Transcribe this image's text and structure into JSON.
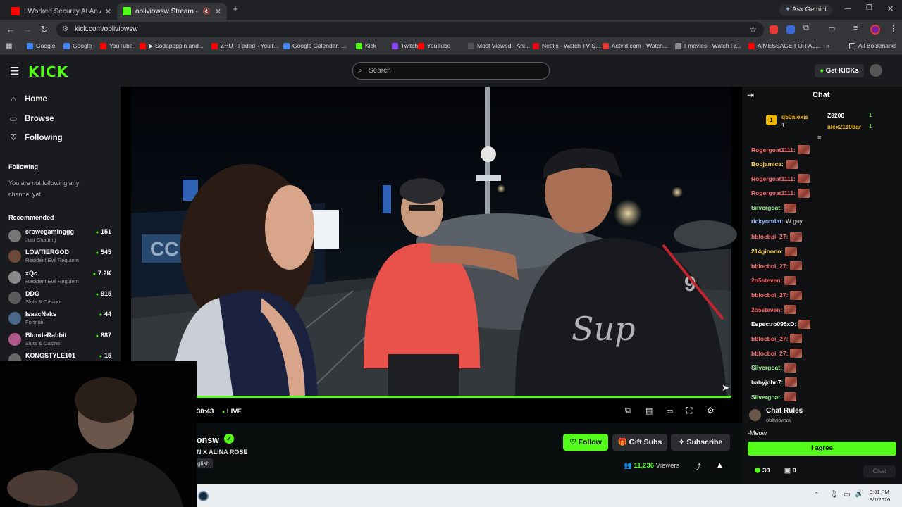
{
  "browser": {
    "tabs": [
      {
        "title": "I Worked Security At An Aband",
        "color": "#ff0000",
        "active": false
      },
      {
        "title": "obliviowsw Stream - Watch",
        "color": "#53fc18",
        "active": true
      }
    ],
    "new_tab": "+",
    "url": "kick.com/obliviowsw",
    "gemini_label": "Ask Gemini",
    "bookmarks": [
      {
        "label": "Google",
        "color": "#4285f4"
      },
      {
        "label": "Google",
        "color": "#4285f4"
      },
      {
        "label": "YouTube",
        "color": "#ff0000"
      },
      {
        "label": "▶ Sodapoppin and...",
        "color": "#ff0000"
      },
      {
        "label": "ZHU - Faded - YouT...",
        "color": "#ff0000"
      },
      {
        "label": "Google Calendar -...",
        "color": "#4285f4"
      },
      {
        "label": "Kick",
        "color": "#53fc18"
      },
      {
        "label": "Twitch",
        "color": "#9146ff"
      },
      {
        "label": "YouTube",
        "color": "#ff0000"
      },
      {
        "label": "Most Viewed - Ani...",
        "color": "#555555"
      },
      {
        "label": "Netflix - Watch TV S...",
        "color": "#e50914"
      },
      {
        "label": "Actvid.com - Watch...",
        "color": "#e53935"
      },
      {
        "label": "Fmovies - Watch Fr...",
        "color": "#888888"
      },
      {
        "label": "A MESSAGE FOR AL...",
        "color": "#ff0000"
      }
    ],
    "all_bookmarks": "All Bookmarks"
  },
  "header": {
    "logo": "KICK",
    "search_placeholder": "Search",
    "get_kicks": "Get KICKs"
  },
  "sidebar": {
    "nav": [
      {
        "label": "Home",
        "icon": "home-icon"
      },
      {
        "label": "Browse",
        "icon": "browse-icon"
      },
      {
        "label": "Following",
        "icon": "heart-icon"
      }
    ],
    "following_heading": "Following",
    "following_empty": "You are not following any channel yet.",
    "recommended_heading": "Recommended",
    "recommended": [
      {
        "name": "crowegaminggg",
        "category": "Just Chatting",
        "viewers": "151",
        "color": "#777"
      },
      {
        "name": "LOWTIERGOD",
        "category": "Resident Evil Requiem",
        "viewers": "545",
        "color": "#6b4a3a"
      },
      {
        "name": "xQc",
        "category": "Resident Evil Requiem",
        "viewers": "7.2K",
        "color": "#888"
      },
      {
        "name": "DDG",
        "category": "Slots & Casino",
        "viewers": "915",
        "color": "#5a5a5a"
      },
      {
        "name": "IsaacNaks",
        "category": "Fortnite",
        "viewers": "44",
        "color": "#4a6a8a"
      },
      {
        "name": "BlondeRabbit",
        "category": "Slots & Casino",
        "viewers": "887",
        "color": "#b05a8a"
      },
      {
        "name": "KONGSTYLE101",
        "category": "",
        "viewers": "15",
        "color": "#666"
      }
    ]
  },
  "player": {
    "time": "30:43",
    "live": "LIVE",
    "progress": 1.0
  },
  "stream": {
    "channel": "onsw",
    "title": "N X ALINA ROSE",
    "tag": "glish",
    "follow": "Follow",
    "gift_subs": "Gift Subs",
    "subscribe": "Subscribe",
    "viewers": "11,236",
    "viewers_label": "Viewers"
  },
  "chat": {
    "title": "Chat",
    "gifters": [
      {
        "name": "q50alexis",
        "count": "1"
      },
      {
        "name": "Z8200",
        "count": "1"
      },
      {
        "name": "alex2110bar",
        "count": "1"
      }
    ],
    "messages": [
      {
        "user": "Rogergoat1111:",
        "text": "",
        "emote": true,
        "color": "#ff6b6b"
      },
      {
        "user": "Boojamice:",
        "text": "",
        "emote": true,
        "color": "#ffd35c"
      },
      {
        "user": "Rogergoat1111:",
        "text": "",
        "emote": true,
        "color": "#ff6b6b"
      },
      {
        "user": "Rogergoat1111:",
        "text": "",
        "emote": true,
        "color": "#ff6b6b"
      },
      {
        "user": "Silvergoat:",
        "text": "",
        "emote": true,
        "color": "#a9f5a0"
      },
      {
        "user": "rickyondat:",
        "text": "W guy",
        "emote": false,
        "color": "#8fb3ff"
      },
      {
        "user": "bblocboi_27:",
        "text": "",
        "emote": true,
        "color": "#ff6b6b"
      },
      {
        "user": "214gioooo:",
        "text": "",
        "emote": true,
        "color": "#ffd35c"
      },
      {
        "user": "bblocboi_27:",
        "text": "",
        "emote": true,
        "color": "#ff6b6b"
      },
      {
        "user": "2o5steven:",
        "text": "",
        "emote": true,
        "color": "#ff5555"
      },
      {
        "user": "bblocboi_27:",
        "text": "",
        "emote": true,
        "color": "#ff6b6b"
      },
      {
        "user": "2o5steven:",
        "text": "",
        "emote": true,
        "color": "#ff5555"
      },
      {
        "user": "Espectro095xD:",
        "text": "",
        "emote": true,
        "color": "#ffffff"
      },
      {
        "user": "bblocboi_27:",
        "text": "",
        "emote": true,
        "color": "#ff6b6b"
      },
      {
        "user": "bblocboi_27:",
        "text": "",
        "emote": true,
        "color": "#ff6b6b"
      },
      {
        "user": "Silvergoat:",
        "text": "",
        "emote": true,
        "color": "#a9f5a0"
      },
      {
        "user": "babyjohn7:",
        "text": "",
        "emote": true,
        "color": "#ffffff"
      },
      {
        "user": "Silvergoat:",
        "text": "",
        "emote": true,
        "color": "#a9f5a0"
      }
    ],
    "rules_title": "Chat Rules",
    "rules_channel": "obliviowsw",
    "rules_text": "-Meow",
    "agree": "I agree",
    "points": "30",
    "gifts": "0",
    "chat_button": "Chat"
  },
  "taskbar": {
    "time": "8:31 PM",
    "date": "3/1/2026"
  },
  "colors": {
    "accent": "#53fc18",
    "bg": "#0b0e0f",
    "panel": "#191b1f"
  }
}
